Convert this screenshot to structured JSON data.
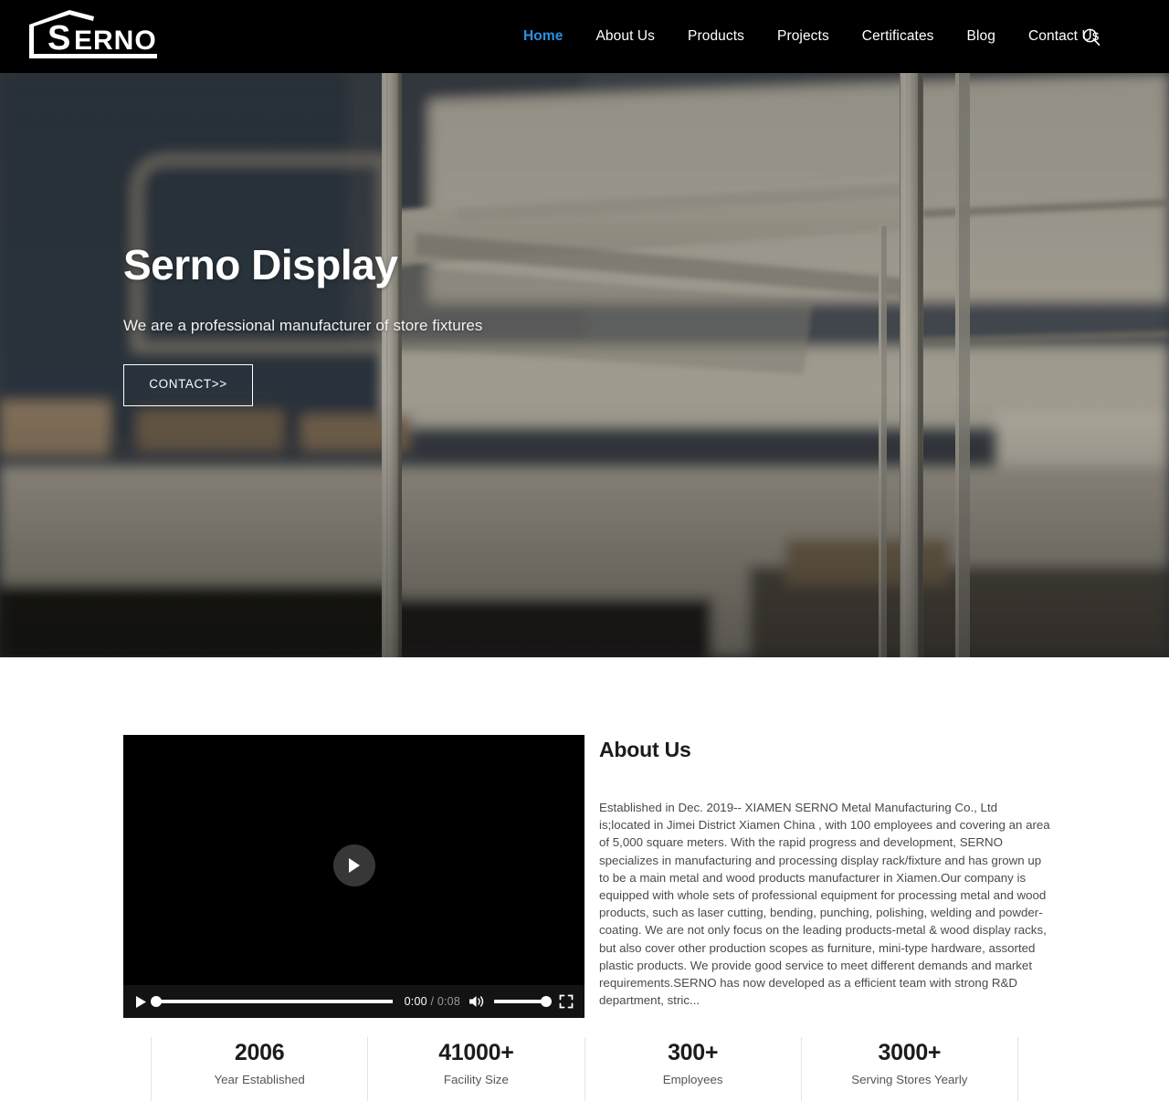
{
  "header": {
    "logo_text": "SERNO",
    "logo_icon": "house-outline-logo",
    "nav": [
      {
        "label": "Home",
        "active": true
      },
      {
        "label": "About Us",
        "active": false
      },
      {
        "label": "Products",
        "active": false
      },
      {
        "label": "Projects",
        "active": false
      },
      {
        "label": "Certificates",
        "active": false
      },
      {
        "label": "Blog",
        "active": false
      },
      {
        "label": "Contact Us",
        "active": false
      }
    ],
    "search_icon": "search-icon",
    "accent_color": "#2f8fe0",
    "background_color": "#000000"
  },
  "hero": {
    "title": "Serno Display",
    "subtitle": "We are a professional manufacturer of store fixtures",
    "cta_label": "CONTACT>>",
    "image_alt": "blurred metal store fixture display rack in showroom"
  },
  "about": {
    "heading": "About Us",
    "body": "Established in Dec. 2019-- XIAMEN SERNO Metal Manufacturing Co., Ltd is;located in Jimei District Xiamen China , with 100 employees and covering an area of 5,000 square meters. With the rapid progress and development, SERNO specializes in manufacturing and processing display rack/fixture and has grown up to be a main metal and wood products manufacturer in Xiamen.Our company is equipped with whole sets of professional equipment for processing metal and wood products, such as laser cutting, bending, punching, polishing, welding and powder-coating. We are not only focus on the leading products-metal & wood display racks, but also cover other production scopes as furniture, mini-type hardware, assorted plastic products. We provide good service to meet different demands and market requirements.SERNO has now developed as a efficient team with strong R&D department, stric..."
  },
  "video": {
    "play_icon": "play-icon",
    "play_button_icon": "play-button-icon",
    "current_time": "0:00",
    "separator": "/",
    "duration": "0:08",
    "mute_icon": "volume-icon",
    "fullscreen_icon": "fullscreen-icon"
  },
  "stats": [
    {
      "value": "2006",
      "label": "Year Established"
    },
    {
      "value": "41000+",
      "label": "Facility Size"
    },
    {
      "value": "300+",
      "label": "Employees"
    },
    {
      "value": "3000+",
      "label": "Serving Stores Yearly"
    }
  ]
}
